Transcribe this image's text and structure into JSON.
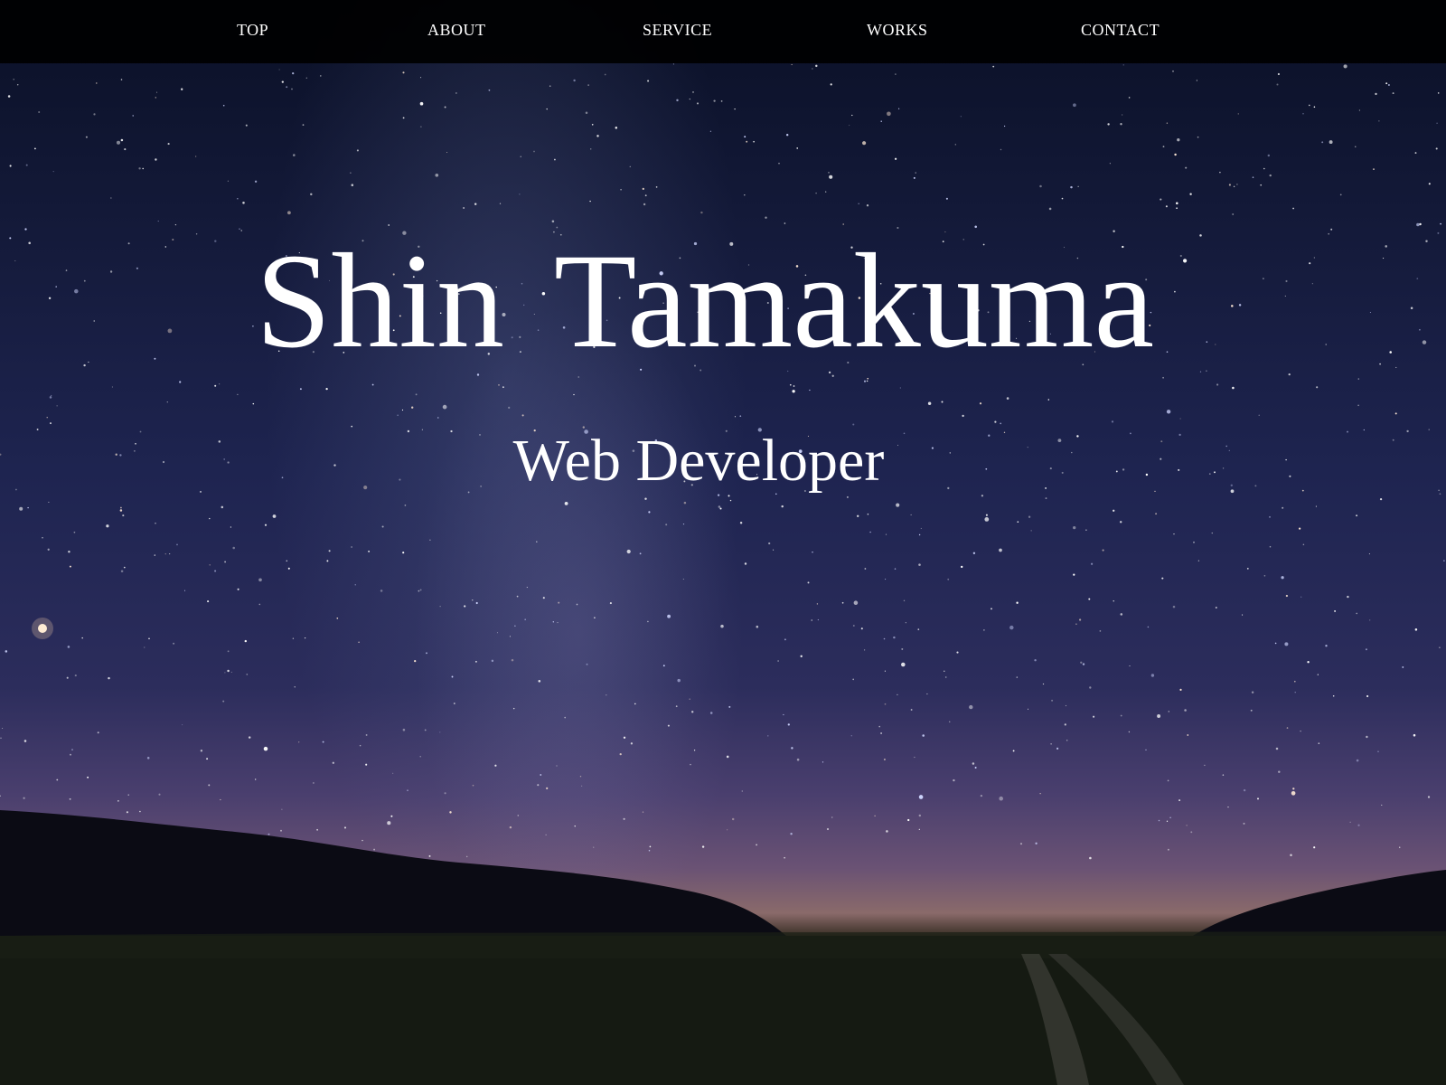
{
  "nav": {
    "items": [
      {
        "label": "TOP"
      },
      {
        "label": "ABOUT"
      },
      {
        "label": "SERVICE"
      },
      {
        "label": "WORKS"
      },
      {
        "label": "CONTACT"
      }
    ]
  },
  "hero": {
    "title": "Shin Tamakuma",
    "subtitle": "Web Developer"
  },
  "colors": {
    "nav_background": "#000000",
    "text": "#ffffff",
    "sky": "#141a3a"
  }
}
